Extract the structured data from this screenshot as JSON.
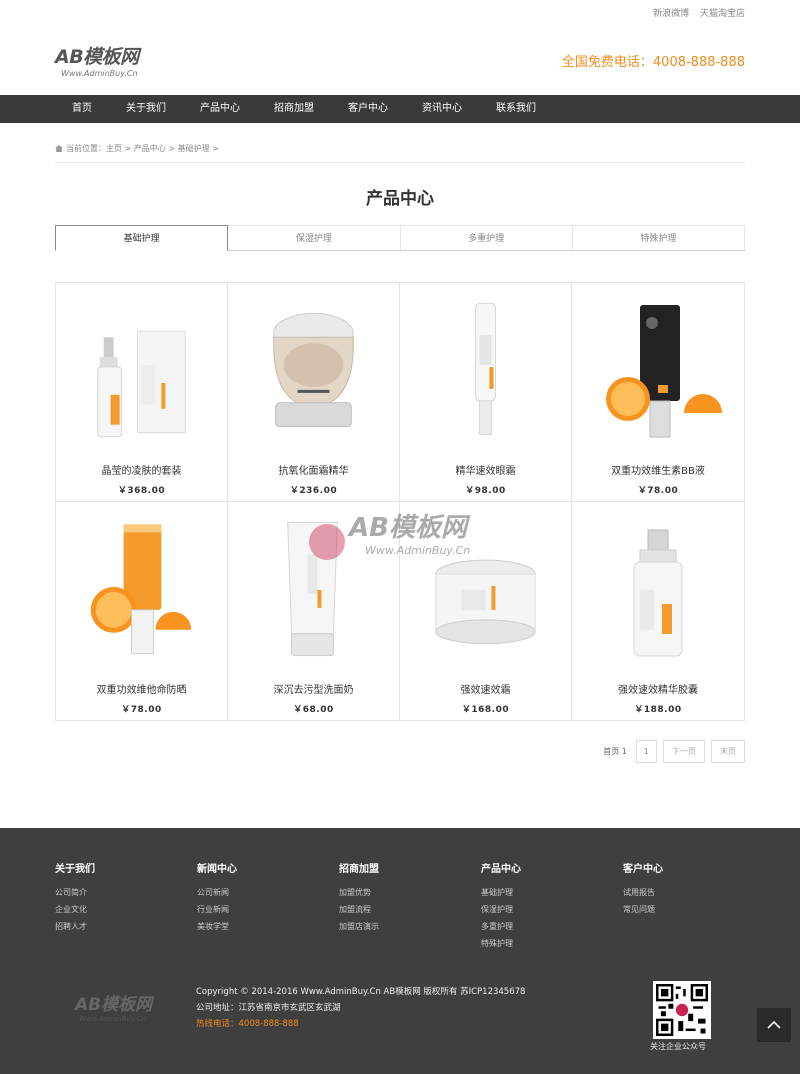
{
  "topbar": {
    "links": [
      "新浪微博",
      "天猫淘宝店"
    ]
  },
  "header": {
    "logo_main": "AB模板网",
    "logo_sub": "Www.AdminBuy.Cn",
    "hotline": "全国免费电话：4008-888-888"
  },
  "nav": {
    "items": [
      "首页",
      "关于我们",
      "产品中心",
      "招商加盟",
      "客户中心",
      "资讯中心",
      "联系我们"
    ]
  },
  "breadcrumb": {
    "text": "当前位置：主页 > 产品中心 > 基础护理 >"
  },
  "page_title": "产品中心",
  "tabs": [
    "基础护理",
    "保湿护理",
    "多重护理",
    "特殊护理"
  ],
  "products": [
    {
      "name": "晶莹的凌肤的套装",
      "price": "￥368.00"
    },
    {
      "name": "抗氧化面霜精华",
      "price": "￥236.00"
    },
    {
      "name": "精华速效眼霜",
      "price": "￥98.00"
    },
    {
      "name": "双重功效维生素BB液",
      "price": "￥78.00"
    },
    {
      "name": "双重功效维他命防晒",
      "price": "￥78.00"
    },
    {
      "name": "深沉去污型洗面奶",
      "price": "￥68.00"
    },
    {
      "name": "强效速效霜",
      "price": "￥168.00"
    },
    {
      "name": "强效速效精华胶囊",
      "price": "￥188.00"
    }
  ],
  "watermark": {
    "main": "AB模板网",
    "sub": "Www.AdminBuy.Cn"
  },
  "pager": {
    "label": "首页 1",
    "current": "1",
    "next": "下一页",
    "last": "末页"
  },
  "footer": {
    "columns": [
      {
        "title": "关于我们",
        "items": [
          "公司简介",
          "企业文化",
          "招聘人才"
        ]
      },
      {
        "title": "新闻中心",
        "items": [
          "公司新闻",
          "行业新闻",
          "美妆学堂"
        ]
      },
      {
        "title": "招商加盟",
        "items": [
          "加盟优势",
          "加盟流程",
          "加盟店演示"
        ]
      },
      {
        "title": "产品中心",
        "items": [
          "基础护理",
          "保湿护理",
          "多重护理",
          "特殊护理"
        ]
      },
      {
        "title": "客户中心",
        "items": [
          "试用报告",
          "常见问题"
        ]
      }
    ],
    "logo_main": "AB模板网",
    "logo_sub": "Www.AdminBuy.Cn",
    "copyright": "Copyright © 2014-2016 Www.AdminBuy.Cn AB模板网 版权所有 苏ICP12345678",
    "address": "公司地址：江苏省南京市玄武区玄武湖",
    "hotline": "热线电话：4008-888-888",
    "qr_caption": "关注企业公众号"
  },
  "colors": {
    "accent": "#f08c1d",
    "nav_bg": "#3a3a3a",
    "footer_bg": "#3f3f3f"
  },
  "icons": {
    "home": "home-icon",
    "back_to_top": "chevron-up-icon"
  }
}
